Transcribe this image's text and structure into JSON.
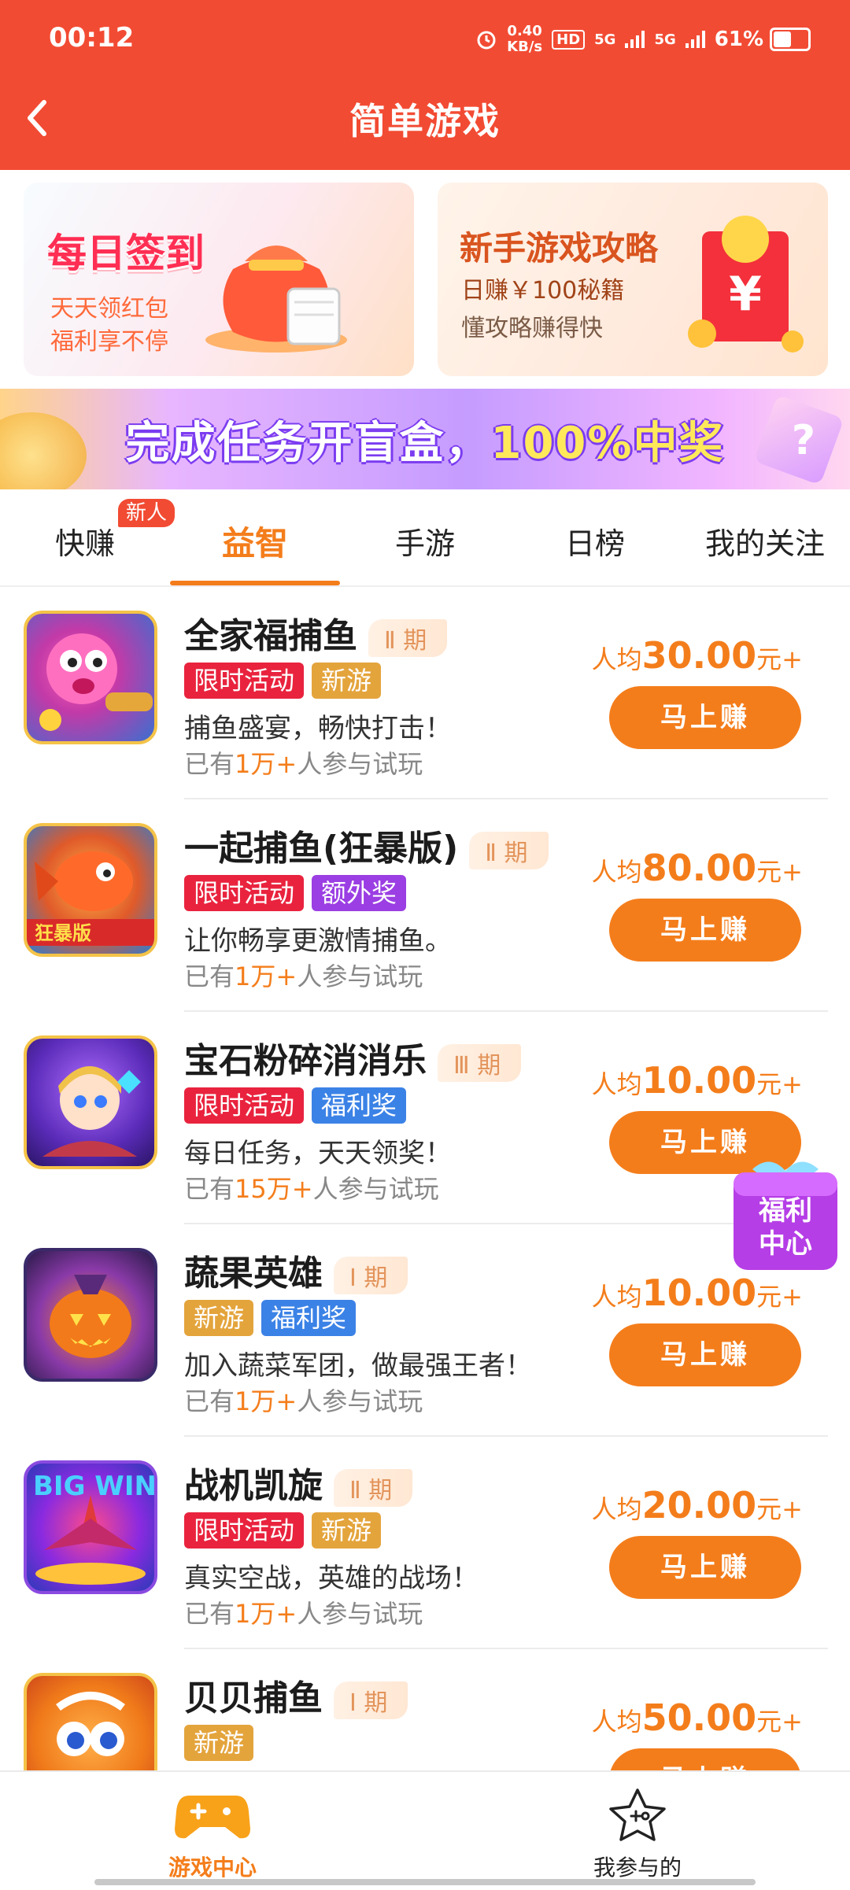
{
  "status_bar": {
    "time": "00:12",
    "speed_value": "0.40",
    "speed_unit": "KB/s",
    "hd": "HD",
    "net1": "5G",
    "net2": "5G",
    "battery": "61%",
    "battery_level": 0.61
  },
  "header": {
    "title": "简单游戏"
  },
  "banners": {
    "signin": {
      "title": "每日签到",
      "line1": "天天领红包",
      "line2": "福利享不停"
    },
    "guide": {
      "title": "新手游戏攻略",
      "line1": "日赚￥100秘籍",
      "line2": "懂攻略赚得快"
    },
    "promo": {
      "text_a": "完成任务开盲盒，",
      "text_b": "100%中奖"
    }
  },
  "tabs": {
    "items": [
      "快赚",
      "益智",
      "手游",
      "日榜",
      "我的关注"
    ],
    "new_badge": "新人",
    "active_index": 1
  },
  "games": [
    {
      "name": "全家福捕鱼",
      "period": "Ⅱ 期",
      "tags": [
        "限时活动",
        "新游"
      ],
      "desc": "捕鱼盛宴，畅快打击！",
      "players_prefix": "已有",
      "players_num": "1万+",
      "players_suffix": "人参与试玩",
      "reward_prefix": "人均",
      "reward_amount": "30.00",
      "reward_suffix": "元+",
      "button": "马上赚"
    },
    {
      "name": "一起捕鱼(狂暴版)",
      "period": "Ⅱ 期",
      "tags": [
        "限时活动",
        "额外奖"
      ],
      "desc": "让你畅享更激情捕鱼。",
      "players_prefix": "已有",
      "players_num": "1万+",
      "players_suffix": "人参与试玩",
      "reward_prefix": "人均",
      "reward_amount": "80.00",
      "reward_suffix": "元+",
      "button": "马上赚"
    },
    {
      "name": "宝石粉碎消消乐",
      "period": "Ⅲ 期",
      "tags": [
        "限时活动",
        "福利奖"
      ],
      "desc": "每日任务，天天领奖！",
      "players_prefix": "已有",
      "players_num": "15万+",
      "players_suffix": "人参与试玩",
      "reward_prefix": "人均",
      "reward_amount": "10.00",
      "reward_suffix": "元+",
      "button": "马上赚"
    },
    {
      "name": "蔬果英雄",
      "period": "Ⅰ 期",
      "tags": [
        "新游",
        "福利奖"
      ],
      "desc": "加入蔬菜军团，做最强王者！",
      "players_prefix": "已有",
      "players_num": "1万+",
      "players_suffix": "人参与试玩",
      "reward_prefix": "人均",
      "reward_amount": "10.00",
      "reward_suffix": "元+",
      "button": "马上赚"
    },
    {
      "name": "战机凯旋",
      "period": "Ⅱ 期",
      "tags": [
        "限时活动",
        "新游"
      ],
      "desc": "真实空战，英雄的战场！",
      "players_prefix": "已有",
      "players_num": "1万+",
      "players_suffix": "人参与试玩",
      "reward_prefix": "人均",
      "reward_amount": "20.00",
      "reward_suffix": "元+",
      "button": "马上赚"
    },
    {
      "name": "贝贝捕鱼",
      "period": "Ⅰ 期",
      "tags": [
        "新游"
      ],
      "desc": "",
      "players_prefix": "",
      "players_num": "",
      "players_suffix": "",
      "reward_prefix": "人均",
      "reward_amount": "50.00",
      "reward_suffix": "元+",
      "button": "马上赚"
    }
  ],
  "floating": {
    "welfare": "福利中心"
  },
  "bottom_nav": {
    "game_center": "游戏中心",
    "my_joined": "我参与的"
  },
  "colors": {
    "primary_red": "#f24b33",
    "accent_orange": "#f47d1b",
    "tag_red": "#e9233e",
    "tag_orange": "#e4a43c",
    "tag_purple": "#9b3ee3",
    "tag_blue": "#3b82e6"
  }
}
